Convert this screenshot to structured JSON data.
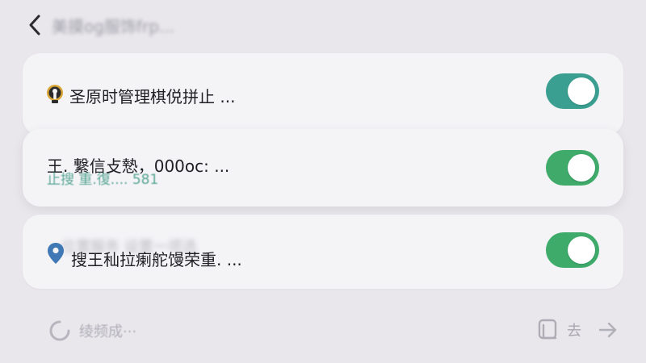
{
  "header": {
    "title": "美摸og服饰frp..."
  },
  "rows": [
    {
      "label": "圣原时管理棋侻拼止 ...",
      "icon": "lock-badge-icon",
      "on": true,
      "color": "#3a9f91"
    },
    {
      "label": "王. 繋信攴慹，000oc: ...",
      "sublabel": "止搜 重.復.... 581",
      "on": true,
      "color": "#3faa6a"
    },
    {
      "label": "搜王秈拉瘌舵馒荣重. ...",
      "ghost": "位置服务 设置一项选",
      "icon": "location-pin-icon",
      "on": true,
      "color": "#3fab6b"
    }
  ],
  "footer": {
    "left_label": "绫频成···",
    "left_icon": "loading-ring-icon",
    "right_label": "去",
    "right_icon": "copy-icon",
    "arrow_icon": "arrow-right-icon"
  },
  "colors": {
    "background": "#e9e7ec",
    "card": "#f4f3f6",
    "toggle_teal": "#3a9f91",
    "toggle_green": "#3faa6a",
    "pin_blue": "#3f78b4"
  }
}
